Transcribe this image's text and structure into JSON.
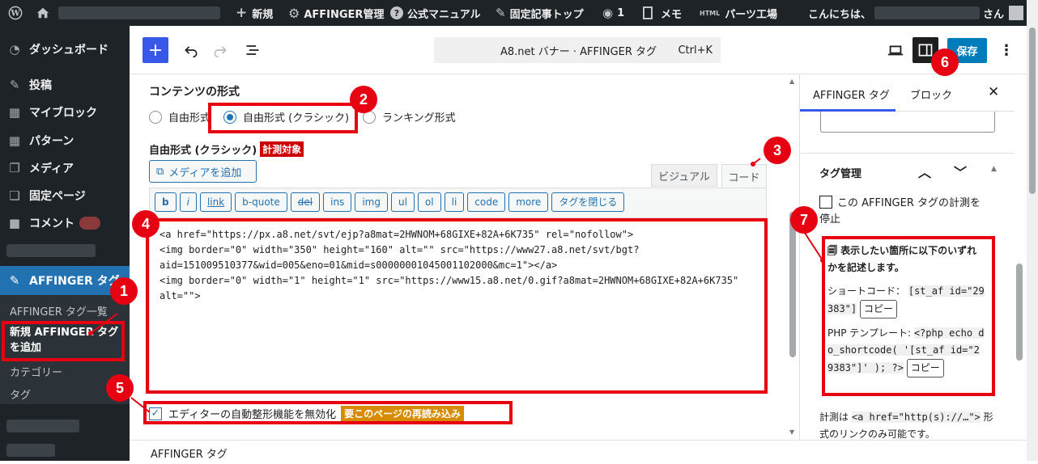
{
  "adminbar": {
    "new": "新規",
    "affinger_manage": "AFFINGER管理",
    "manual": "公式マニュアル",
    "fixed_top": "固定記事トップ",
    "views": "1",
    "memo": "メモ",
    "parts": "パーツ工場",
    "greeting": "こんにちは、",
    "san": "さん"
  },
  "sidebar": {
    "dashboard": "ダッシュボード",
    "posts": "投稿",
    "myblocks": "マイブロック",
    "patterns": "パターン",
    "media": "メディア",
    "pages": "固定ページ",
    "comments": "コメント",
    "affinger_tag": "AFFINGER タグ",
    "sub_list": "AFFINGER タグ一覧",
    "sub_new": "新規 AFFINGER タグを追加",
    "sub_category": "カテゴリー",
    "sub_tag": "タグ"
  },
  "toolbar": {
    "doc_title": "A8.net バナー · AFFINGER タグ",
    "shortcut": "Ctrl+K",
    "save": "保存"
  },
  "content": {
    "section_title": "コンテンツの形式",
    "radio_free": "自由形式",
    "radio_classic": "自由形式 (クラシック)",
    "radio_ranking": "ランキング形式",
    "classic_label": "自由形式 (クラシック)",
    "measure_badge": "計測対象",
    "add_media": "メディアを追加",
    "tab_visual": "ビジュアル",
    "tab_code": "コード",
    "quicktags": [
      "b",
      "i",
      "link",
      "b-quote",
      "del",
      "ins",
      "img",
      "ul",
      "ol",
      "li",
      "code",
      "more",
      "タグを閉じる"
    ],
    "code_lines": [
      "<a href=\"https://px.a8.net/svt/ejp?a8mat=2HWNOM+68GIXE+82A+6K735\" rel=\"nofollow\">",
      "<img border=\"0\" width=\"350\" height=\"160\" alt=\"\" src=\"https://www27.a8.net/svt/bgt?",
      "aid=151009510377&wid=005&eno=01&mid=s00000001045001102000&mc=1\"></a>",
      "<img border=\"0\" width=\"1\" height=\"1\" src=\"https://www15.a8.net/0.gif?a8mat=2HWNOM+68GIXE+82A+6K735\"",
      "alt=\"\">"
    ],
    "disable_label": "エディターの自動整形機能を無効化",
    "reload_badge": "要このページの再読み込み",
    "footer": "AFFINGER タグ"
  },
  "panel": {
    "tab_doc": "AFFINGER タグ",
    "tab_block": "ブロック",
    "section": "タグ管理",
    "stop_label": "この AFFINGER タグの計測を停止",
    "info_title": "表示したい箇所に以下のいずれかを記述します。",
    "shortcode_label": "ショートコード：",
    "shortcode_value": "[st_af id=\"29383\"]",
    "copy": "コピー",
    "php_label": "PHP テンプレート:",
    "php_value": "<?php echo do_shortcode( '[st_af id=\"29383\"]' ); ?>",
    "measure_note_pre": "計測は",
    "measure_note_code": "<a href=\"http(s)://…\">",
    "measure_note_post": "形式のリンクのみ可能です。"
  },
  "annotations": [
    "1",
    "2",
    "3",
    "4",
    "5",
    "6",
    "7"
  ],
  "colors": {
    "accent": "#2271b1",
    "wp_blue": "#3858e9",
    "highlight_red": "#e60012",
    "admin_dark": "#1d2327",
    "reload_orange": "#d78c00",
    "save_blue": "#007cba"
  }
}
